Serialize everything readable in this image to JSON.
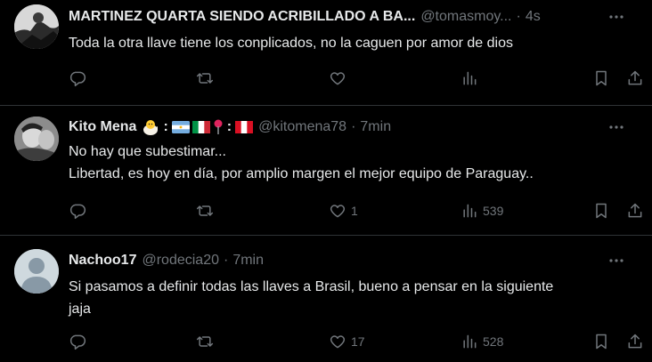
{
  "tweets": [
    {
      "name": "MARTINEZ QUARTA SIENDO ACRIBILLADO A BA...",
      "handle": "@tomasmoy...",
      "time": "4s",
      "lines": [
        "Toda la otra llave tiene los conplicados, no la caguen por amor de dios"
      ],
      "likes": "",
      "views": ""
    },
    {
      "name": "Kito Mena",
      "emoji_colon_1": ":",
      "emoji_colon_2": ":",
      "handle": "@kitomena78",
      "time": "7min",
      "lines": [
        "No hay que subestimar...",
        "Libertad, es hoy en día, por amplio margen el mejor equipo de Paraguay.."
      ],
      "likes": "1",
      "views": "539"
    },
    {
      "name": "Nachoo17",
      "handle": "@rodecia20",
      "time": "7min",
      "lines": [
        "Si pasamos a definir todas las llaves a Brasil, bueno a pensar en la siguiente",
        "jaja"
      ],
      "likes": "17",
      "views": "528"
    }
  ],
  "separator": "·",
  "colors": {
    "background": "#000000",
    "text": "#e7e9ea",
    "muted": "#71767b",
    "border": "#2f3336"
  },
  "icons": [
    "reply-icon",
    "retweet-icon",
    "like-icon",
    "views-icon",
    "bookmark-icon",
    "share-icon",
    "more-icon"
  ]
}
